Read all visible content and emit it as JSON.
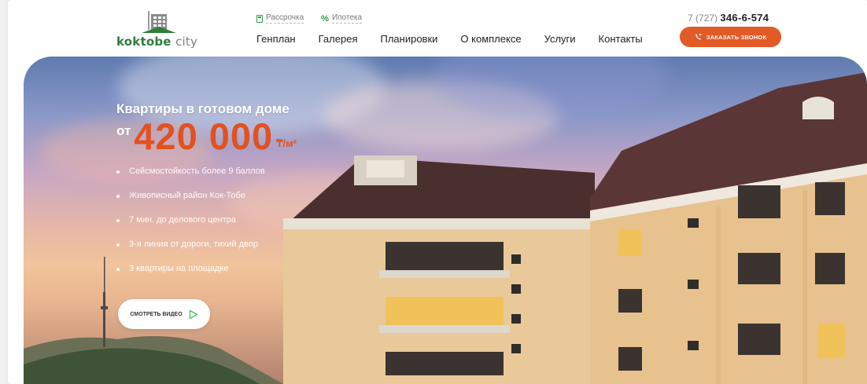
{
  "header": {
    "logo": {
      "part1": "koktobe",
      "part2": "city",
      "icon": "building-logo-icon"
    },
    "top_links": [
      {
        "label": "Рассрочка",
        "icon": "calculator-icon"
      },
      {
        "label": "Ипотека",
        "icon": "percent-icon"
      }
    ],
    "nav": [
      "Генплан",
      "Галерея",
      "Планировки",
      "О комплексе",
      "Услуги",
      "Контакты"
    ],
    "phone": {
      "prefix": "7 (727) ",
      "number": "346-6-574"
    },
    "callback_label": "заказать звонок",
    "colors": {
      "accent": "#e25a26",
      "brand_green": "#2f7d3a"
    }
  },
  "hero": {
    "headline": "Квартиры в готовом доме",
    "price_prefix": "от",
    "price": "420 000",
    "price_unit": "₸/м²",
    "features": [
      "Сейсмостойкость более 9 баллов",
      "Живописный район Кок-Тобе",
      "7 мин. до делового центра",
      "3-я линия от дороги, тихий двор",
      "3 квартиры на площадке"
    ],
    "video_button_label": "смотреть видео",
    "video_icon": "play-triangle-icon"
  }
}
